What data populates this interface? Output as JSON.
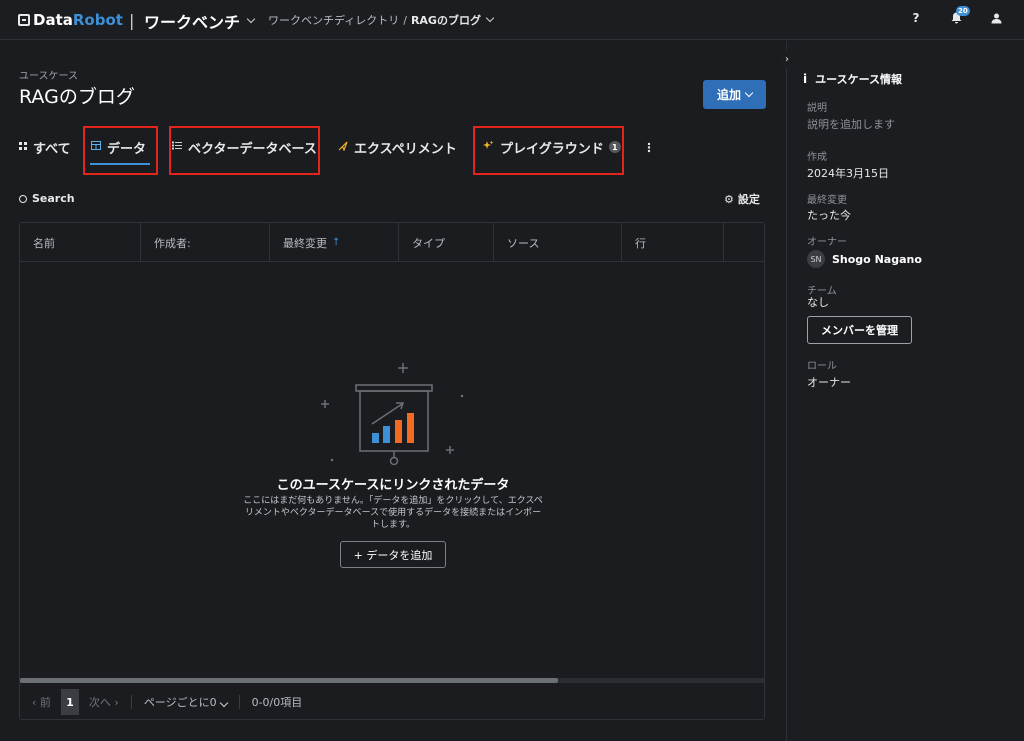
{
  "topbar": {
    "logo_part1": "Data",
    "logo_part2": "Robot",
    "logo_sep": "|",
    "workbench": "ワークベンチ",
    "breadcrumb_dir": "ワークベンチディレクトリ",
    "breadcrumb_sep": "/",
    "breadcrumb_current": "RAGのブログ",
    "help": "?",
    "notifications_count": "20"
  },
  "main": {
    "usecase_label": "ユースケース",
    "title": "RAGのブログ",
    "add_button": "追加",
    "tabs": [
      {
        "label": "すべて",
        "icon": "grid-icon"
      },
      {
        "label": "データ",
        "icon": "table-icon",
        "active": true
      },
      {
        "label": "ベクターデータベース",
        "icon": "vector-db-icon"
      },
      {
        "label": "エクスペリメント",
        "icon": "experiment-icon"
      },
      {
        "label": "プレイグラウンド",
        "icon": "sparkle-icon",
        "count": "1"
      }
    ],
    "search": "Search",
    "settings": "設定",
    "columns": [
      "名前",
      "作成者:",
      "最終変更",
      "タイプ",
      "ソース",
      "行"
    ],
    "sort_arrow": "↑",
    "empty_title": "このユースケースにリンクされたデータ",
    "empty_desc_line1": "ここにはまだ何もありません。「データを追加」をクリックして、エクスペ",
    "empty_desc_line2": "リメントやベクターデータベースで使用するデータを接続またはインポー",
    "empty_desc_line3": "トします。",
    "empty_button": "+ データを追加",
    "pager": {
      "prev": "前",
      "page": "1",
      "next": "次へ",
      "per_page": "ページごとに0",
      "range": "0-0/0項目"
    }
  },
  "panel": {
    "header": "ユースケース情報",
    "desc_label": "説明",
    "desc_value": "説明を追加します",
    "created_label": "作成",
    "created_value": "2024年3月15日",
    "modified_label": "最終変更",
    "modified_value": "たった今",
    "owner_label": "オーナー",
    "owner_initials": "SN",
    "owner_name": "Shogo Nagano",
    "team_label": "チーム",
    "team_value": "なし",
    "manage_button": "メンバーを管理",
    "role_label": "ロール",
    "role_value": "オーナー"
  },
  "colors": {
    "accent": "#3d8fd6",
    "highlight_box": "#e2241b",
    "chart_blue": "#3d8fd6",
    "chart_orange": "#f26b21"
  }
}
